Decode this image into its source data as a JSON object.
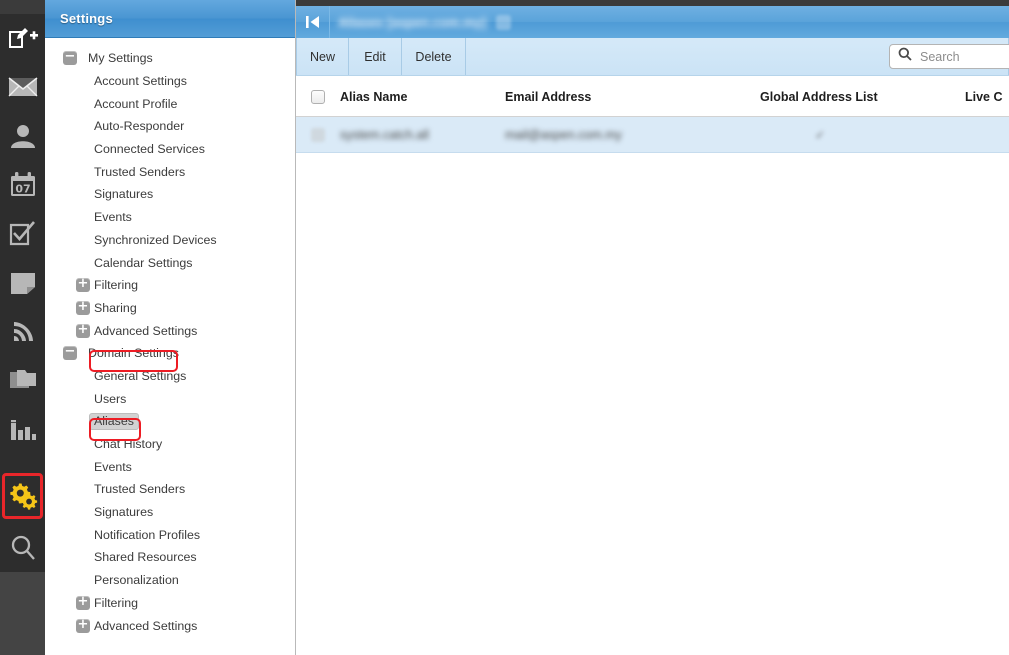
{
  "rail": {
    "icons": [
      {
        "name": "compose-icon",
        "label": "Compose"
      },
      {
        "name": "mail-icon",
        "label": "Mail"
      },
      {
        "name": "contacts-icon",
        "label": "Contacts"
      },
      {
        "name": "calendar-icon",
        "label": "Calendar",
        "day": "07"
      },
      {
        "name": "tasks-icon",
        "label": "Tasks"
      },
      {
        "name": "notes-icon",
        "label": "Notes"
      },
      {
        "name": "feeds-icon",
        "label": "Feeds"
      },
      {
        "name": "files-icon",
        "label": "Files"
      },
      {
        "name": "reports-icon",
        "label": "Reports"
      },
      {
        "name": "settings-gear-icon",
        "label": "Settings"
      },
      {
        "name": "search-icon",
        "label": "Search"
      }
    ],
    "selected_icon": "settings-gear-icon",
    "highlight_color": "#ed1c24"
  },
  "sidebar": {
    "title": "Settings",
    "items": [
      {
        "label": "My Settings",
        "level": 0,
        "toggle": "minus"
      },
      {
        "label": "Account Settings",
        "level": 2,
        "toggle": ""
      },
      {
        "label": "Account Profile",
        "level": 2,
        "toggle": ""
      },
      {
        "label": "Auto-Responder",
        "level": 2,
        "toggle": ""
      },
      {
        "label": "Connected Services",
        "level": 2,
        "toggle": ""
      },
      {
        "label": "Trusted Senders",
        "level": 2,
        "toggle": ""
      },
      {
        "label": "Signatures",
        "level": 2,
        "toggle": ""
      },
      {
        "label": "Events",
        "level": 2,
        "toggle": ""
      },
      {
        "label": "Synchronized Devices",
        "level": 2,
        "toggle": ""
      },
      {
        "label": "Calendar Settings",
        "level": 2,
        "toggle": ""
      },
      {
        "label": "Filtering",
        "level": 1,
        "toggle": "plus"
      },
      {
        "label": "Sharing",
        "level": 1,
        "toggle": "plus"
      },
      {
        "label": "Advanced Settings",
        "level": 1,
        "toggle": "plus"
      },
      {
        "label": "Domain Settings",
        "level": 0,
        "toggle": "minus",
        "highlighted": true
      },
      {
        "label": "General Settings",
        "level": 2,
        "toggle": ""
      },
      {
        "label": "Users",
        "level": 2,
        "toggle": ""
      },
      {
        "label": "Aliases",
        "level": 2,
        "toggle": "",
        "selected": true,
        "highlighted": true
      },
      {
        "label": "Chat History",
        "level": 2,
        "toggle": ""
      },
      {
        "label": "Events",
        "level": 2,
        "toggle": ""
      },
      {
        "label": "Trusted Senders",
        "level": 2,
        "toggle": ""
      },
      {
        "label": "Signatures",
        "level": 2,
        "toggle": ""
      },
      {
        "label": "Notification Profiles",
        "level": 2,
        "toggle": ""
      },
      {
        "label": "Shared Resources",
        "level": 2,
        "toggle": ""
      },
      {
        "label": "Personalization",
        "level": 2,
        "toggle": ""
      },
      {
        "label": "Filtering",
        "level": 1,
        "toggle": "plus"
      },
      {
        "label": "Advanced Settings",
        "level": 1,
        "toggle": "plus"
      }
    ]
  },
  "content": {
    "titlebar": {
      "collapse_icon": "collapse-left-icon",
      "title": "Aliases [aspen.com.my]",
      "redacted": true
    },
    "toolbar": {
      "new_label": "New",
      "edit_label": "Edit",
      "delete_label": "Delete",
      "search_placeholder": "Search",
      "search_value": ""
    },
    "grid": {
      "columns": [
        "Alias Name",
        "Email Address",
        "Global Address List",
        "Live C"
      ],
      "rows": [
        {
          "selected": true,
          "redacted": true,
          "alias_name": "system.catch.all",
          "email_address": "mail@aspen.com.my",
          "global_address_list": "✓",
          "live_chat": ""
        }
      ]
    }
  },
  "colors": {
    "accent_blue": "#5aa3da",
    "row_selected": "#daeaf7",
    "highlight_red": "#ed1c24",
    "gear_yellow": "#f5c518",
    "rail_dark": "#2d2d2d"
  }
}
